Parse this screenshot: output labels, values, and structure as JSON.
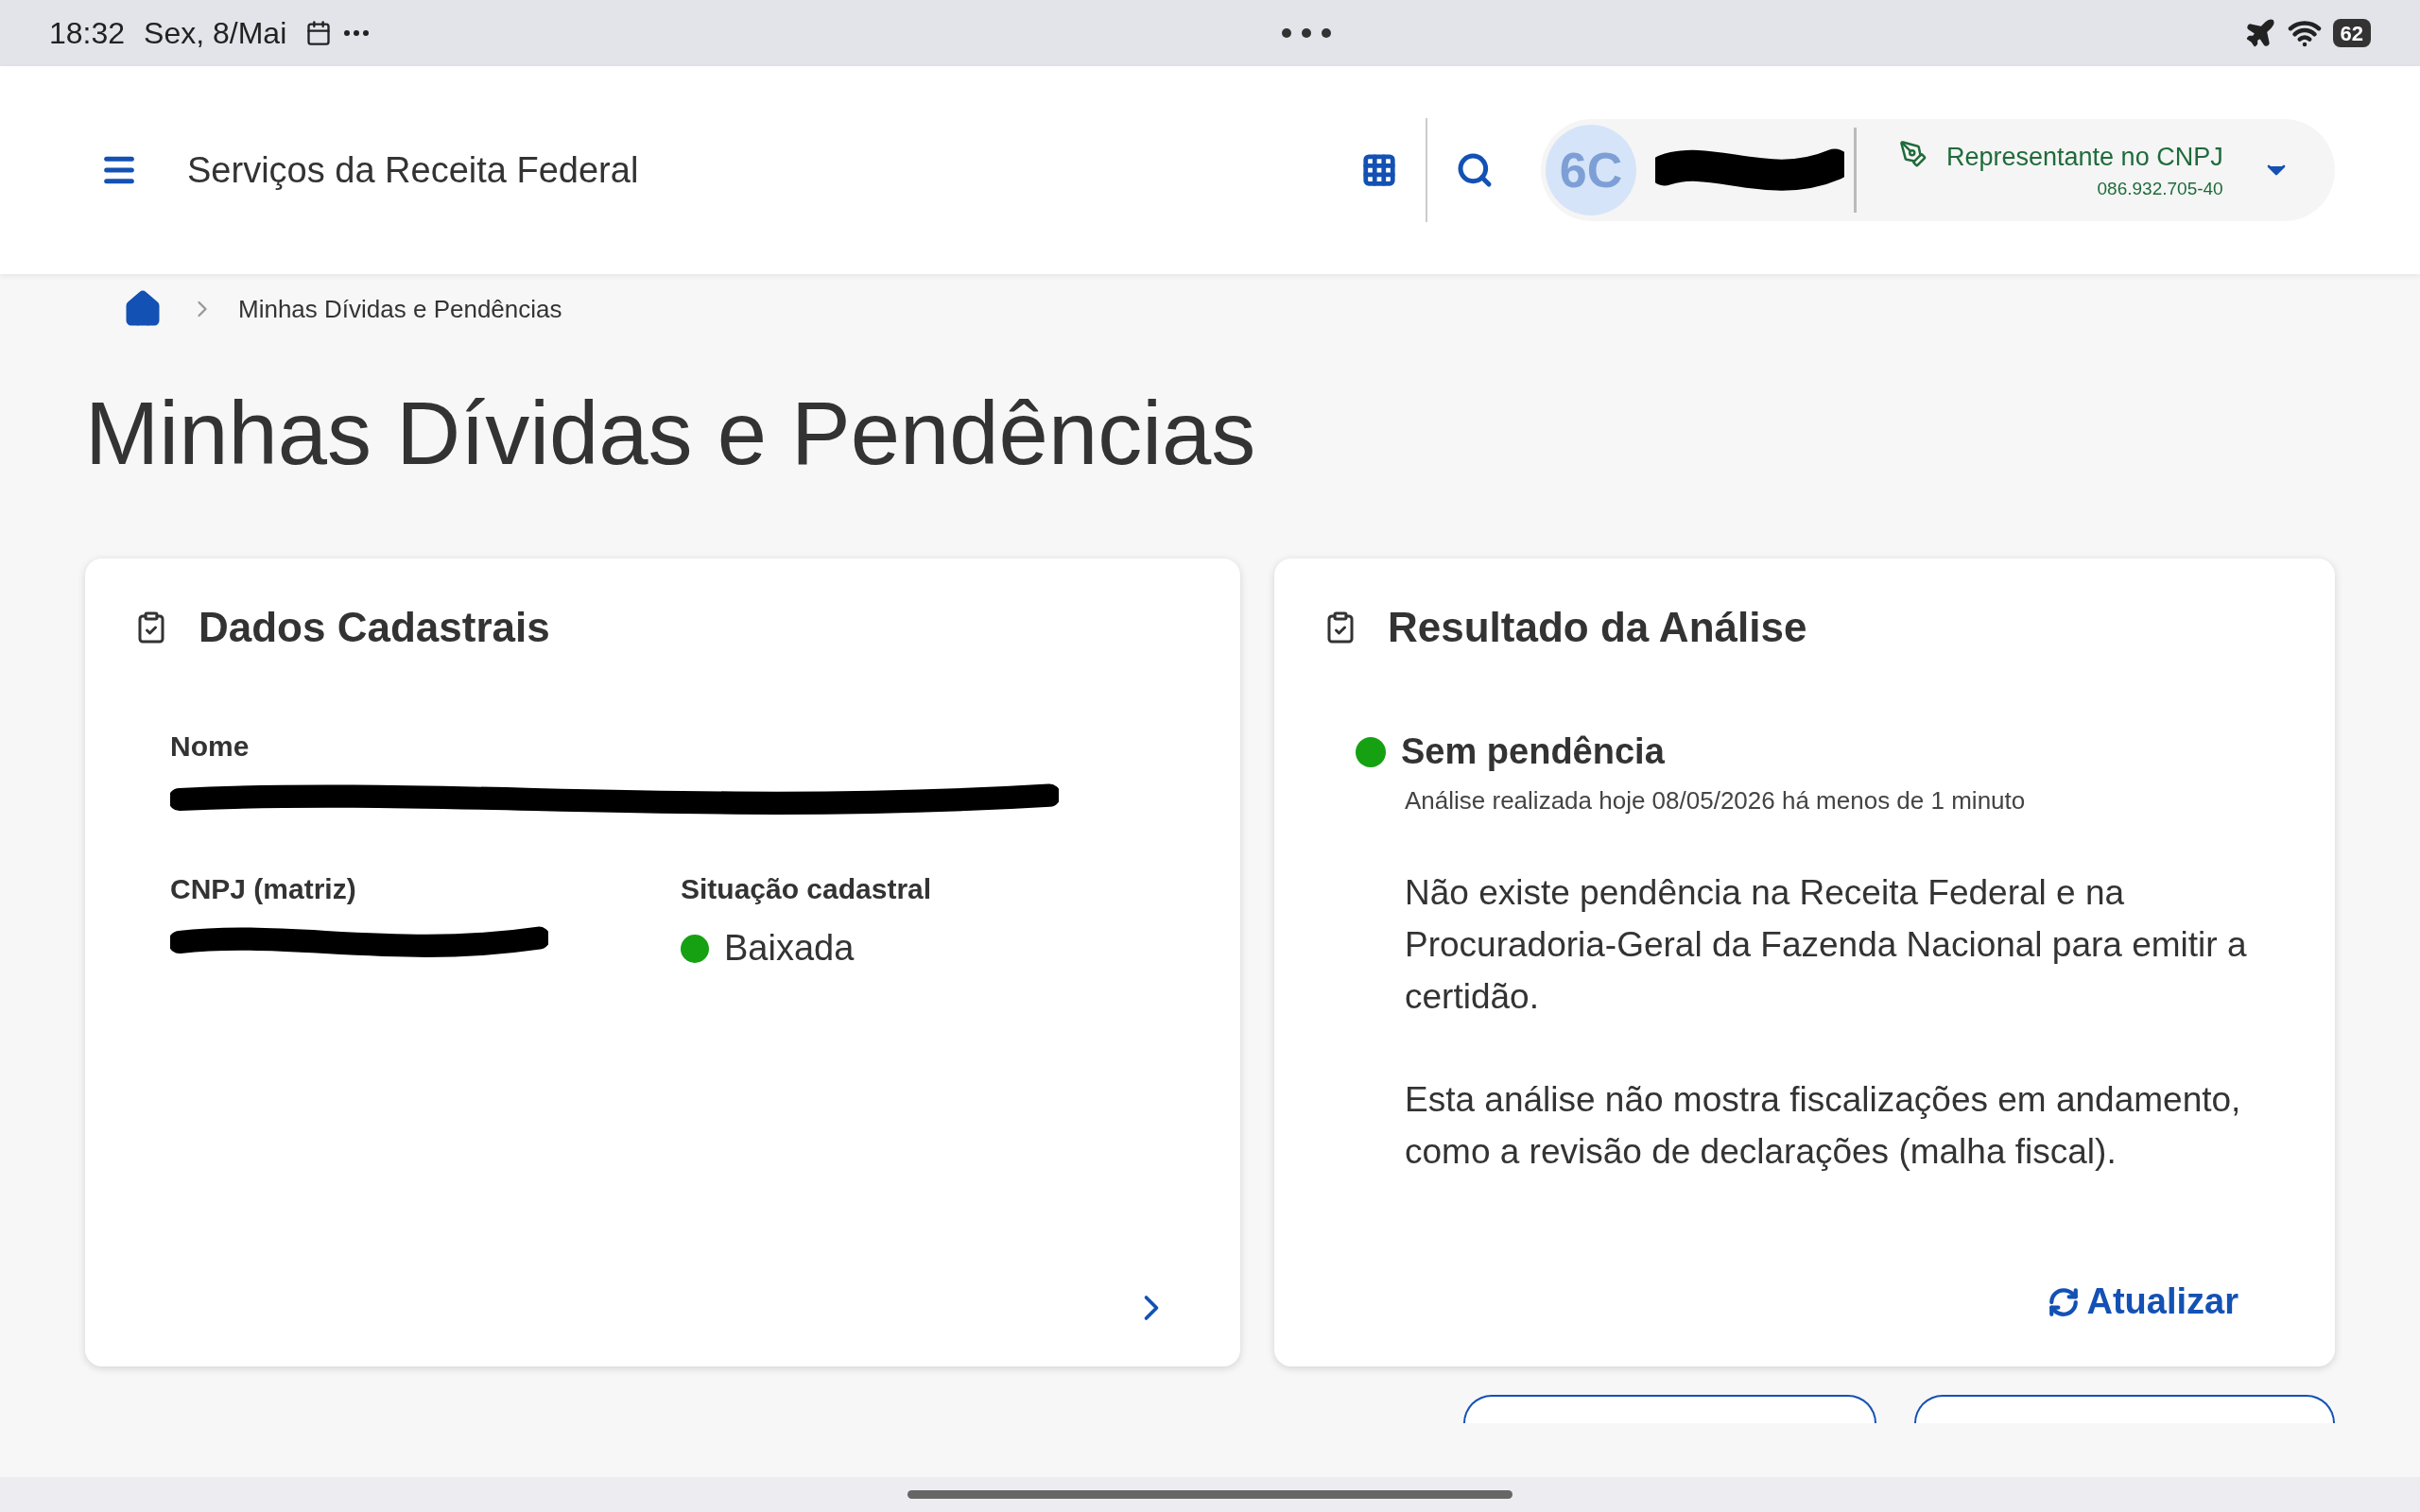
{
  "status_bar": {
    "time": "18:32",
    "date": "Sex, 8/Mai",
    "battery": "62"
  },
  "header": {
    "title": "Serviços da Receita Federal",
    "avatar": "6C",
    "role": "Representante no CNPJ",
    "role_id": "086.932.705-40"
  },
  "breadcrumb": [
    "Minhas Dívidas e Pendências"
  ],
  "page_title": "Minhas Dívidas e Pendências",
  "cards": [
    {
      "kind": "registration",
      "title": "Dados Cadastrais",
      "rows": [
        [
          {
            "kind": "redacted",
            "label": "Nome"
          }
        ],
        [
          {
            "kind": "redacted",
            "label": "CNPJ (matriz)"
          },
          {
            "kind": "value",
            "label": "Situação cadastral",
            "value": "Baixada",
            "color": "#16a112"
          }
        ]
      ]
    },
    {
      "kind": "result",
      "title": "Resultado da Análise",
      "status": "Sem pendência",
      "color": "#16a112",
      "subtitle": "Análise realizada hoje 08/05/2026 há menos de 1 minuto",
      "paragraphs": [
        "Não existe pendência na Receita Federal e na Procuradoria-Geral da Fazenda Nacional para emitir a certidão.",
        "Esta análise não mostra fiscalizações em andamento, como a revisão de declarações (malha fiscal)."
      ],
      "action": "Atualizar"
    }
  ]
}
